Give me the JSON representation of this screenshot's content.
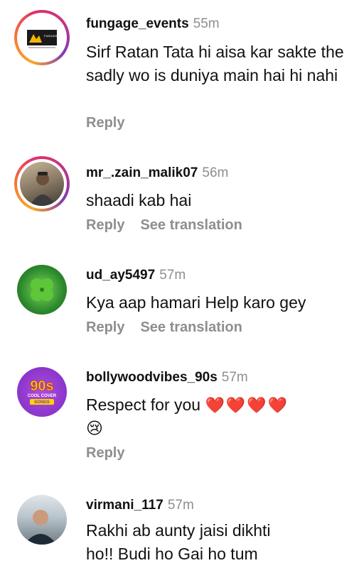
{
  "comments": [
    {
      "username": "fungage_events",
      "time": "55m",
      "text": "Sirf Ratan Tata hi aisa kar sakte the sadly wo is duniya main hai hi nahi",
      "reply_label": "Reply",
      "avatar_text": "FUNGAGE"
    },
    {
      "username": "mr_.zain_malik07",
      "time": "56m",
      "text": "shaadi kab hai",
      "reply_label": "Reply",
      "translation_label": "See translation"
    },
    {
      "username": "ud_ay5497",
      "time": "57m",
      "text": "Kya aap hamari Help karo gey",
      "reply_label": "Reply",
      "translation_label": "See translation"
    },
    {
      "username": "bollywoodvibes_90s",
      "time": "57m",
      "text": "Respect for you",
      "emoji_hearts": "❤️❤️❤️❤️",
      "emoji_cry": "😢",
      "reply_label": "Reply",
      "avatar_big": "90s",
      "avatar_small1": "COOL COVER",
      "avatar_small2": "SONGS"
    },
    {
      "username": "virmani_117",
      "time": "57m",
      "text": "Rakhi ab aunty jaisi dikhti ho!! Budi ho Gai ho tum"
    }
  ]
}
